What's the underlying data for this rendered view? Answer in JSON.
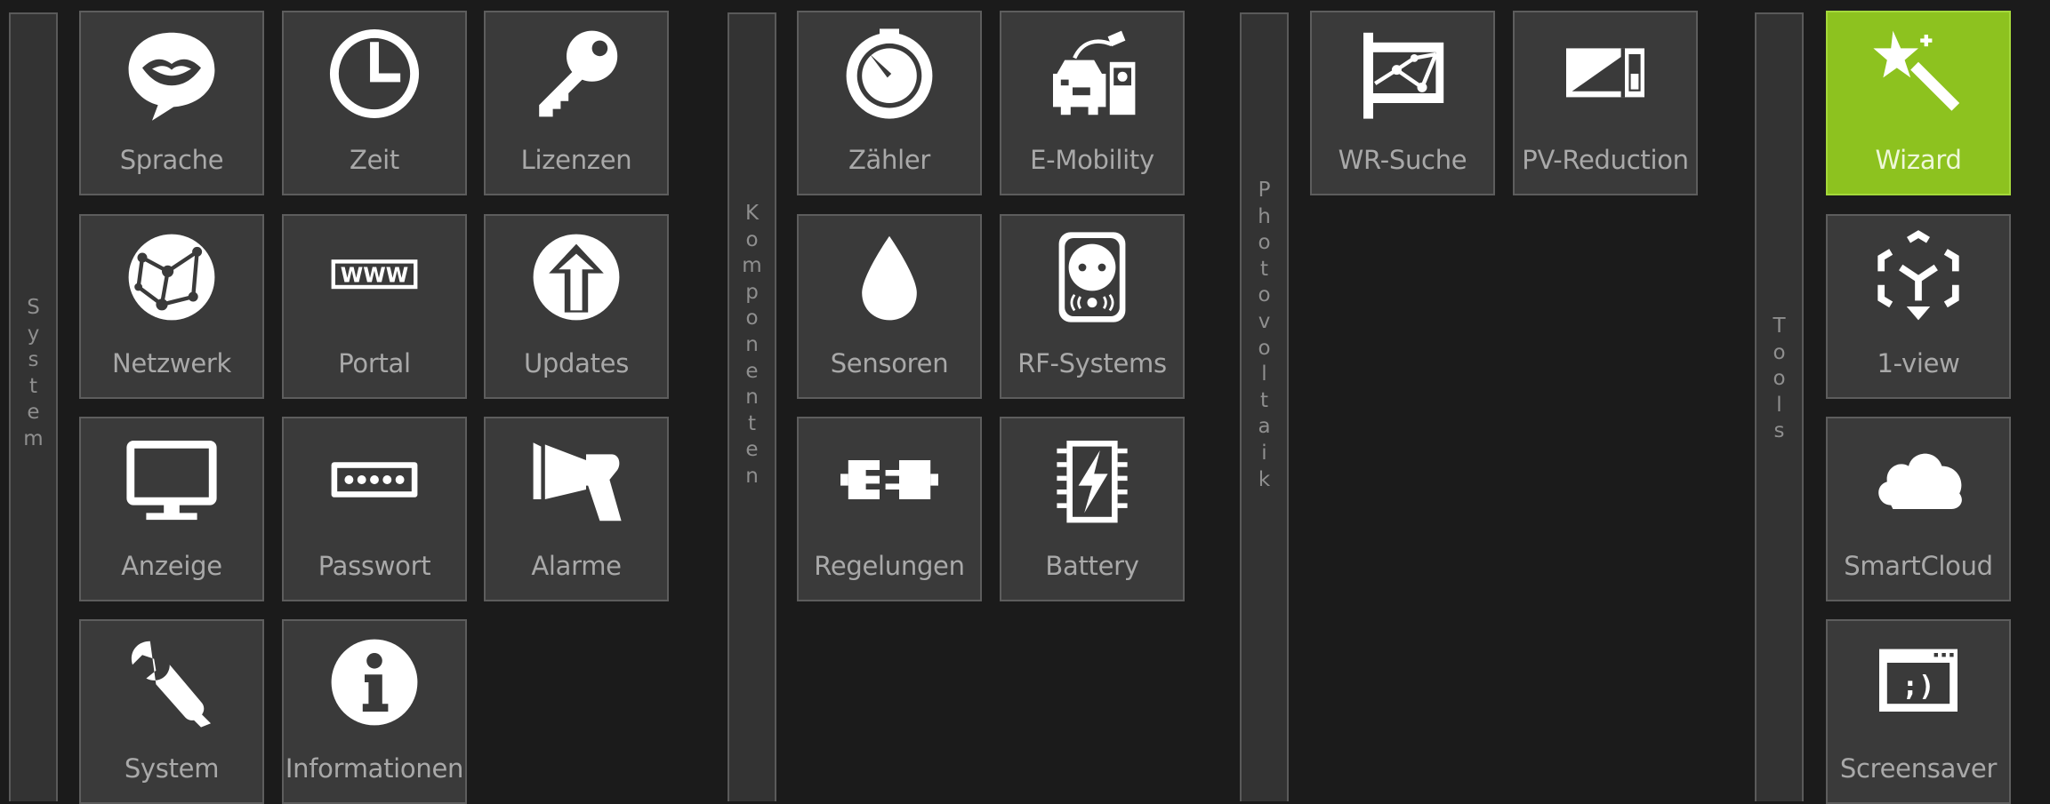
{
  "sections": [
    {
      "id": "system",
      "label_letters": [
        "S",
        "y",
        "s",
        "t",
        "e",
        "m"
      ]
    },
    {
      "id": "komponenten",
      "label_letters": [
        "K",
        "o",
        "m",
        "p",
        "o",
        "n",
        "e",
        "n",
        "t",
        "e",
        "n"
      ]
    },
    {
      "id": "photovoltaik",
      "label_letters": [
        "P",
        "h",
        "o",
        "t",
        "o",
        "v",
        "o",
        "l",
        "t",
        "a",
        "i",
        "k"
      ]
    },
    {
      "id": "tools",
      "label_letters": [
        "T",
        "o",
        "o",
        "l",
        "s"
      ]
    }
  ],
  "tiles": {
    "sprache": "Sprache",
    "zeit": "Zeit",
    "lizenzen": "Lizenzen",
    "netzwerk": "Netzwerk",
    "portal": "Portal",
    "updates": "Updates",
    "anzeige": "Anzeige",
    "passwort": "Passwort",
    "alarme": "Alarme",
    "system": "System",
    "informationen": "Informationen",
    "zaehler": "Zähler",
    "emobility": "E-Mobility",
    "sensoren": "Sensoren",
    "rfsystems": "RF-Systems",
    "regelungen": "Regelungen",
    "battery": "Battery",
    "wrsuche": "WR-Suche",
    "pvreduction": "PV-Reduction",
    "wizard": "Wizard",
    "oneview": "1-view",
    "smartcloud": "SmartCloud",
    "screensaver": "Screensaver"
  },
  "icons": {
    "portal_text": "WWW",
    "screensaver_text": ";)"
  },
  "colors": {
    "background": "#1b1b1b",
    "tile": "#3a3a3a",
    "tile_border": "#5d5d5d",
    "active_tile": "#8dc21f",
    "label": "#a9a9a9",
    "section_letters": "#8f8f8f"
  }
}
